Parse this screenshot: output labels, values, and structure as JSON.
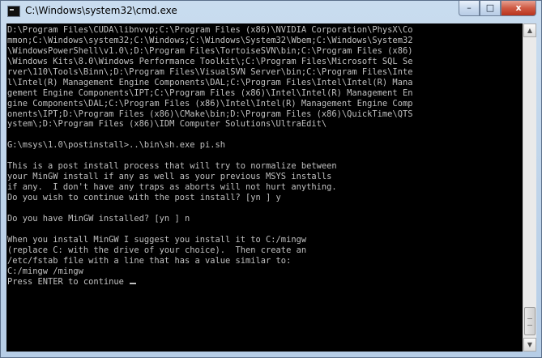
{
  "window": {
    "title": "C:\\Windows\\system32\\cmd.exe",
    "icon": "cmd-console-icon",
    "controls": {
      "minimize": "–",
      "maximize": "□",
      "close": "x"
    }
  },
  "console": {
    "lines": [
      "D:\\Program Files\\CUDA\\libnvvp;C:\\Program Files (x86)\\NVIDIA Corporation\\PhysX\\Co",
      "mmon;C:\\Windows\\system32;C:\\Windows;C:\\Windows\\System32\\Wbem;C:\\Windows\\System32",
      "\\WindowsPowerShell\\v1.0\\;D:\\Program Files\\TortoiseSVN\\bin;C:\\Program Files (x86)",
      "\\Windows Kits\\8.0\\Windows Performance Toolkit\\;C:\\Program Files\\Microsoft SQL Se",
      "rver\\110\\Tools\\Binn\\;D:\\Program Files\\VisualSVN Server\\bin;C:\\Program Files\\Inte",
      "l\\Intel(R) Management Engine Components\\DAL;C:\\Program Files\\Intel\\Intel(R) Mana",
      "gement Engine Components\\IPT;C:\\Program Files (x86)\\Intel\\Intel(R) Management En",
      "gine Components\\DAL;C:\\Program Files (x86)\\Intel\\Intel(R) Management Engine Comp",
      "onents\\IPT;D:\\Program Files (x86)\\CMake\\bin;D:\\Program Files (x86)\\QuickTime\\QTS",
      "ystem\\;D:\\Program Files (x86)\\IDM Computer Solutions\\UltraEdit\\",
      "",
      "G:\\msys\\1.0\\postinstall>..\\bin\\sh.exe pi.sh",
      "",
      "This is a post install process that will try to normalize between",
      "your MinGW install if any as well as your previous MSYS installs",
      "if any.  I don't have any traps as aborts will not hurt anything.",
      "Do you wish to continue with the post install? [yn ] y",
      "",
      "Do you have MinGW installed? [yn ] n",
      "",
      "When you install MinGW I suggest you install it to C:/mingw",
      "(replace C: with the drive of your choice).  Then create an",
      "/etc/fstab file with a line that has a value similar to:",
      "C:/mingw /mingw",
      "Press ENTER to continue "
    ]
  },
  "scrollbar": {
    "up_arrow": "▲",
    "down_arrow": "▼"
  }
}
